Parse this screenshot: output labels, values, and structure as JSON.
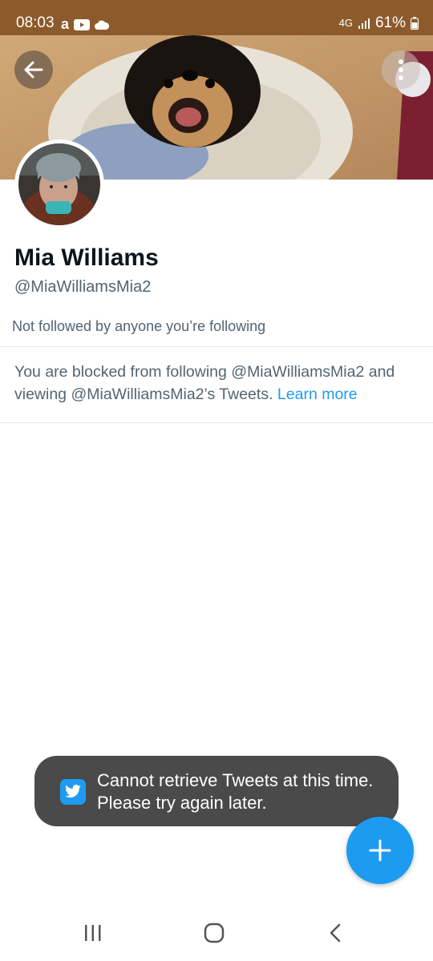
{
  "status_bar": {
    "time": "08:03",
    "battery": "61%",
    "network": "4G",
    "background_color": "#8d5a2b"
  },
  "profile": {
    "display_name": "Mia Williams",
    "handle": "@MiaWilliamsMia2",
    "followers_note": "Not followed by anyone you’re following",
    "blocked_message": "You are blocked from following @MiaWilliamsMia2 and viewing @MiaWilliamsMia2’s Tweets.",
    "learn_more": "Learn more"
  },
  "toast": {
    "message": "Cannot retrieve Tweets at this time. Please try again later."
  },
  "icons": {
    "back": "arrow-left-icon",
    "more": "more-vertical-icon",
    "compose": "plus-icon",
    "toast": "twitter-bird-icon",
    "nav_recents": "recents-icon",
    "nav_home": "home-icon",
    "nav_back": "chevron-left-icon"
  },
  "colors": {
    "accent": "#1d9bf0",
    "text_primary": "#0f1419",
    "text_secondary": "#536471",
    "toast_bg": "#4a4a4a"
  }
}
